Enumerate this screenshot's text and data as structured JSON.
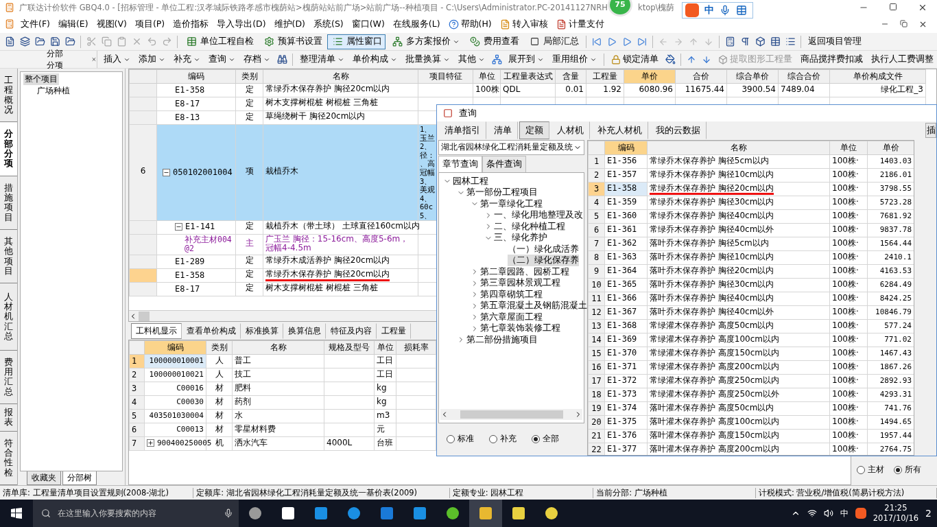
{
  "window": {
    "title": "广联达计价软件 GBQ4.0 - [招标管理 - 单位工程:汉孝城际铁路孝感市槐荫站>槐荫站站前广场>站前广场--种植项目 - C:\\Users\\Administrator.PC-20141127NRH",
    "title_tail": "ktop\\槐荫"
  },
  "badge": "75",
  "ime": {
    "label": "中"
  },
  "menu": [
    {
      "label": "文件(F)",
      "kind": "plain"
    },
    {
      "label": "编辑(E)",
      "kind": "plain"
    },
    {
      "label": "视图(V)",
      "kind": "plain"
    },
    {
      "label": "项目(P)",
      "kind": "plain"
    },
    {
      "label": "造价指标",
      "kind": "plain"
    },
    {
      "label": "导入导出(D)",
      "kind": "plain"
    },
    {
      "label": "维护(D)",
      "kind": "plain"
    },
    {
      "label": "系统(S)",
      "kind": "plain"
    },
    {
      "label": "窗口(W)",
      "kind": "plain"
    },
    {
      "label": "在线服务(L)",
      "kind": "plain"
    },
    {
      "label": "帮助(H)",
      "kind": "help"
    },
    {
      "label": "转入审核",
      "kind": "review"
    },
    {
      "label": "计量支付",
      "kind": "pay"
    }
  ],
  "toolbar1": [
    {
      "kind": "button",
      "label": "单位工程自检",
      "pressed": false
    },
    {
      "kind": "button",
      "label": "预算书设置",
      "pressed": false
    },
    {
      "kind": "button",
      "label": "属性窗口",
      "pressed": true
    },
    {
      "kind": "dropdown",
      "label": "多方案报价",
      "pressed": false
    },
    {
      "kind": "button",
      "label": "费用查看",
      "pressed": false
    },
    {
      "kind": "checkbox",
      "label": "局部汇总",
      "checked": false
    },
    {
      "kind": "plain",
      "label": "返回项目管理"
    }
  ],
  "left_panel": {
    "title": "分部分项",
    "tree": [
      {
        "label": "整个项目",
        "selected": true,
        "children": [
          {
            "label": "广场种植",
            "selected": false
          }
        ]
      }
    ],
    "tabs": [
      {
        "label": "收藏夹",
        "selected": false
      },
      {
        "label": "分部树",
        "selected": true
      }
    ]
  },
  "toolbar2": [
    {
      "label": "插入",
      "dropdown": true,
      "disabled": false
    },
    {
      "label": "添加",
      "dropdown": true,
      "disabled": false
    },
    {
      "label": "补充",
      "dropdown": true,
      "disabled": false
    },
    {
      "label": "查询",
      "dropdown": true,
      "disabled": false
    },
    {
      "label": "存档",
      "dropdown": true,
      "disabled": false
    },
    {
      "label": "整理清单",
      "dropdown": true,
      "disabled": false
    },
    {
      "label": "单价构成",
      "dropdown": true,
      "disabled": false
    },
    {
      "label": "批量换算",
      "dropdown": true,
      "disabled": false
    },
    {
      "label": "其他",
      "dropdown": true,
      "disabled": false
    },
    {
      "label": "展开到",
      "dropdown": true,
      "disabled": false
    },
    {
      "label": "重用组价",
      "dropdown": true,
      "disabled": false
    },
    {
      "label": "锁定清单",
      "dropdown": false,
      "disabled": false
    },
    {
      "label": "提取图形工程量",
      "dropdown": false,
      "disabled": true
    },
    {
      "label": "商品搅拌费扣减",
      "dropdown": false,
      "disabled": false
    },
    {
      "label": "执行人工费调整",
      "dropdown": false,
      "disabled": false
    }
  ],
  "side_tabs": [
    {
      "label": "工程概况",
      "selected": false
    },
    {
      "label": "分部分项",
      "selected": true
    },
    {
      "label": "措施项目",
      "selected": false
    },
    {
      "label": "其他项目",
      "selected": false
    },
    {
      "label": "人材机汇总",
      "selected": false
    },
    {
      "label": "费用汇总",
      "selected": false
    },
    {
      "label": "报表",
      "selected": false
    },
    {
      "label": "符合性检",
      "selected": false
    }
  ],
  "table": {
    "columns": [
      "编码",
      "类别",
      "名称",
      "项目特征",
      "单位",
      "工程量表达式",
      "含量",
      "工程量",
      "单价",
      "合价",
      "综合单价",
      "综合合价",
      "单价构成文件"
    ],
    "rows": [
      {
        "kind": "quota",
        "code": "E1-358",
        "type": "定",
        "name": "常绿乔木保存养护 胸径20cm以内",
        "current": false,
        "underlined": false,
        "values": [
          "100株",
          "QDL",
          "0.01",
          "1.92",
          "6080.96",
          "11675.44",
          "3900.54",
          "7489.04",
          "绿化工程_3"
        ]
      },
      {
        "kind": "quota",
        "code": "E8-17",
        "type": "定",
        "name": "树木支撑树棍桩 树棍桩 三角桩",
        "current": false,
        "underlined": false
      },
      {
        "kind": "quota",
        "code": "E8-13",
        "type": "定",
        "name": "草绳绕树干 胸径20cm以内",
        "current": false,
        "underlined": false
      },
      {
        "kind": "item",
        "number": "6",
        "code": "050102001004",
        "type": "项",
        "name": "栽植乔木",
        "selected": true,
        "expanded": true,
        "features": [
          "1、",
          "玉兰",
          "2、",
          "径：",
          "、高",
          "冠幅",
          "3、",
          "美观",
          "4、",
          "60c",
          "5、"
        ],
        "children": [
          {
            "kind": "quota",
            "code": "E1-141",
            "type": "定",
            "name": "栽植乔木（带土球） 土球直径160cm以内",
            "expanded": true,
            "current": false,
            "underlined": false,
            "children": [
              {
                "kind": "material",
                "code": "补充主材004@2",
                "type": "主",
                "name": "广玉兰 胸径：15-16cm、高度5-6m，冠幅4-4.5m",
                "current": false,
                "underlined": false
              }
            ]
          },
          {
            "kind": "quota",
            "code": "E1-289",
            "type": "定",
            "name": "常绿乔木成活养护 胸径20cm以内",
            "current": false,
            "underlined": false
          },
          {
            "kind": "quota",
            "code": "E1-358",
            "type": "定",
            "name": "常绿乔木保存养护 胸径20cm以内",
            "current": true,
            "underlined": true
          },
          {
            "kind": "quota",
            "code": "E8-17",
            "type": "定",
            "name": "树木支撑树棍桩 树棍桩 三角桩",
            "current": false,
            "underlined": false
          }
        ]
      }
    ]
  },
  "bottom_tabs": [
    {
      "label": "工料机显示",
      "selected": true
    },
    {
      "label": "查看单价构成",
      "selected": false
    },
    {
      "label": "标准换算",
      "selected": false
    },
    {
      "label": "换算信息",
      "selected": false
    },
    {
      "label": "特征及内容",
      "selected": false
    },
    {
      "label": "工程量",
      "selected": false
    }
  ],
  "resources": {
    "columns": [
      "编码",
      "类别",
      "名称",
      "规格及型号",
      "单位",
      "损耗率"
    ],
    "rows": [
      {
        "number": "1",
        "code": "100000010001",
        "type": "人",
        "name": "普工",
        "spec": "",
        "unit": "工日",
        "selected": true,
        "expandable": false
      },
      {
        "number": "2",
        "code": "100000010021",
        "type": "人",
        "name": "技工",
        "spec": "",
        "unit": "工日",
        "selected": false,
        "expandable": false
      },
      {
        "number": "3",
        "code": "C00016",
        "type": "材",
        "name": "肥料",
        "spec": "",
        "unit": "kg",
        "selected": false,
        "expandable": false
      },
      {
        "number": "4",
        "code": "C00030",
        "type": "材",
        "name": "药剂",
        "spec": "",
        "unit": "kg",
        "selected": false,
        "expandable": false
      },
      {
        "number": "5",
        "code": "403501030004",
        "type": "材",
        "name": "水",
        "spec": "",
        "unit": "m3",
        "selected": false,
        "expandable": false
      },
      {
        "number": "6",
        "code": "C00013",
        "type": "材",
        "name": "零星材料费",
        "spec": "",
        "unit": "元",
        "selected": false,
        "expandable": false
      },
      {
        "number": "7",
        "code": "900400250005",
        "type": "机",
        "name": "洒水汽车",
        "spec": "4000L",
        "unit": "台班",
        "selected": false,
        "expandable": true
      }
    ]
  },
  "property_radios": [
    {
      "label": "主材",
      "selected": false
    },
    {
      "label": "所有",
      "selected": true
    }
  ],
  "dialog": {
    "title": "查询",
    "tabs": [
      {
        "label": "清单指引",
        "selected": false
      },
      {
        "label": "清单",
        "selected": false
      },
      {
        "label": "定额",
        "selected": true
      },
      {
        "label": "人材机",
        "selected": false
      },
      {
        "label": "补充人材机",
        "selected": false
      },
      {
        "label": "我的云数据",
        "selected": false
      }
    ],
    "side_button": "插",
    "library": "湖北省园林绿化工程消耗量定额及统",
    "search_tabs": [
      {
        "label": "章节查询",
        "selected": true
      },
      {
        "label": "条件查询",
        "selected": false
      }
    ],
    "tree": [
      {
        "label": "园林工程",
        "expanded": true,
        "selected": false,
        "children": [
          {
            "label": "第一部份工程项目",
            "expanded": true,
            "selected": false,
            "children": [
              {
                "label": "第一章绿化工程",
                "expanded": true,
                "selected": false,
                "children": [
                  {
                    "label": "一、绿化用地整理及改",
                    "expanded": false,
                    "selected": false
                  },
                  {
                    "label": "二、绿化种植工程",
                    "expanded": false,
                    "selected": false
                  },
                  {
                    "label": "三、绿化养护",
                    "expanded": true,
                    "selected": false,
                    "children": [
                      {
                        "label": "（一）绿化成活养",
                        "selected": false
                      },
                      {
                        "label": "（二）绿化保存养",
                        "selected": true
                      }
                    ]
                  }
                ]
              },
              {
                "label": "第二章园路、园桥工程",
                "expanded": false,
                "selected": false
              },
              {
                "label": "第三章园林景观工程",
                "expanded": false,
                "selected": false
              },
              {
                "label": "第四章砌筑工程",
                "expanded": false,
                "selected": false
              },
              {
                "label": "第五章混凝土及钢筋混凝土",
                "expanded": false,
                "selected": false
              },
              {
                "label": "第六章屋面工程",
                "expanded": false,
                "selected": false
              },
              {
                "label": "第七章装饰装修工程",
                "expanded": false,
                "selected": false
              }
            ]
          },
          {
            "label": "第二部份措施项目",
            "expanded": false,
            "selected": false
          }
        ]
      }
    ],
    "scope": [
      {
        "label": "标准",
        "selected": false
      },
      {
        "label": "补充",
        "selected": false
      },
      {
        "label": "全部",
        "selected": true
      }
    ],
    "columns": [
      "编码",
      "名称",
      "单位",
      "单价"
    ],
    "rows": [
      {
        "number": "1",
        "code": "E1-356",
        "name": "常绿乔木保存养护 胸径5cm以内",
        "unit": "100株·",
        "price": "1403.03",
        "selected": false,
        "underlined": false
      },
      {
        "number": "2",
        "code": "E1-357",
        "name": "常绿乔木保存养护 胸径10cm以内",
        "unit": "100株·",
        "price": "2186.01",
        "selected": false,
        "underlined": false
      },
      {
        "number": "3",
        "code": "E1-358",
        "name": "常绿乔木保存养护 胸径20cm以内",
        "unit": "100株·",
        "price": "3798.55",
        "selected": true,
        "underlined": true
      },
      {
        "number": "4",
        "code": "E1-359",
        "name": "常绿乔木保存养护 胸径30cm以内",
        "unit": "100株·",
        "price": "5723.28",
        "selected": false,
        "underlined": false
      },
      {
        "number": "5",
        "code": "E1-360",
        "name": "常绿乔木保存养护 胸径40cm以内",
        "unit": "100株·",
        "price": "7681.92",
        "selected": false,
        "underlined": false
      },
      {
        "number": "6",
        "code": "E1-361",
        "name": "常绿乔木保存养护 胸径40cm以外",
        "unit": "100株·",
        "price": "9837.78",
        "selected": false,
        "underlined": false
      },
      {
        "number": "7",
        "code": "E1-362",
        "name": "落叶乔木保存养护 胸径5cm以内",
        "unit": "100株·",
        "price": "1564.44",
        "selected": false,
        "underlined": false
      },
      {
        "number": "8",
        "code": "E1-363",
        "name": "落叶乔木保存养护 胸径10cm以内",
        "unit": "100株·",
        "price": "2410.1",
        "selected": false,
        "underlined": false
      },
      {
        "number": "9",
        "code": "E1-364",
        "name": "落叶乔木保存养护 胸径20cm以内",
        "unit": "100株·",
        "price": "4163.53",
        "selected": false,
        "underlined": false
      },
      {
        "number": "10",
        "code": "E1-365",
        "name": "落叶乔木保存养护 胸径30cm以内",
        "unit": "100株·",
        "price": "6284.49",
        "selected": false,
        "underlined": false
      },
      {
        "number": "11",
        "code": "E1-366",
        "name": "落叶乔木保存养护 胸径40cm以内",
        "unit": "100株·",
        "price": "8424.25",
        "selected": false,
        "underlined": false
      },
      {
        "number": "12",
        "code": "E1-367",
        "name": "落叶乔木保存养护 胸径40cm以外",
        "unit": "100株·",
        "price": "10846.79",
        "selected": false,
        "underlined": false
      },
      {
        "number": "13",
        "code": "E1-368",
        "name": "常绿灌木保存养护 高度50cm以内",
        "unit": "100株·",
        "price": "577.24",
        "selected": false,
        "underlined": false
      },
      {
        "number": "14",
        "code": "E1-369",
        "name": "常绿灌木保存养护 高度100cm以内",
        "unit": "100株·",
        "price": "771.02",
        "selected": false,
        "underlined": false
      },
      {
        "number": "15",
        "code": "E1-370",
        "name": "常绿灌木保存养护 高度150cm以内",
        "unit": "100株·",
        "price": "1467.43",
        "selected": false,
        "underlined": false
      },
      {
        "number": "16",
        "code": "E1-371",
        "name": "常绿灌木保存养护 高度200cm以内",
        "unit": "100株·",
        "price": "1867.26",
        "selected": false,
        "underlined": false
      },
      {
        "number": "17",
        "code": "E1-372",
        "name": "常绿灌木保存养护 高度250cm以内",
        "unit": "100株·",
        "price": "2892.93",
        "selected": false,
        "underlined": false
      },
      {
        "number": "18",
        "code": "E1-373",
        "name": "常绿灌木保存养护 高度250cm以外",
        "unit": "100株·",
        "price": "4293.31",
        "selected": false,
        "underlined": false
      },
      {
        "number": "19",
        "code": "E1-374",
        "name": "落叶灌木保存养护 高度50cm以内",
        "unit": "100株·",
        "price": "741.76",
        "selected": false,
        "underlined": false
      },
      {
        "number": "20",
        "code": "E1-375",
        "name": "落叶灌木保存养护 高度100cm以内",
        "unit": "100株·",
        "price": "1494.65",
        "selected": false,
        "underlined": false
      },
      {
        "number": "21",
        "code": "E1-376",
        "name": "落叶灌木保存养护 高度150cm以内",
        "unit": "100株·",
        "price": "1957.44",
        "selected": false,
        "underlined": false
      },
      {
        "number": "22",
        "code": "E1-377",
        "name": "落叶灌木保存养护 高度200cm以内",
        "unit": "100株·",
        "price": "2764.75",
        "selected": false,
        "underlined": false
      }
    ]
  },
  "status_bar": [
    {
      "label": "清单库:",
      "value": "工程量清单项目设置规则(2008-湖北)"
    },
    {
      "label": "定额库:",
      "value": "湖北省园林绿化工程消耗量定额及统一基价表(2009)"
    },
    {
      "label": "定额专业:",
      "value": "园林工程"
    },
    {
      "label": "当前分部:",
      "value": "广场种植"
    },
    {
      "label": "计税模式:",
      "value": "营业税/增值税(简易计税方法)"
    }
  ],
  "taskbar": {
    "search_placeholder": "在这里输入你要搜索的内容",
    "input_method": "中",
    "time": "21:25",
    "date": "2017/10/16",
    "notifications": "2"
  }
}
